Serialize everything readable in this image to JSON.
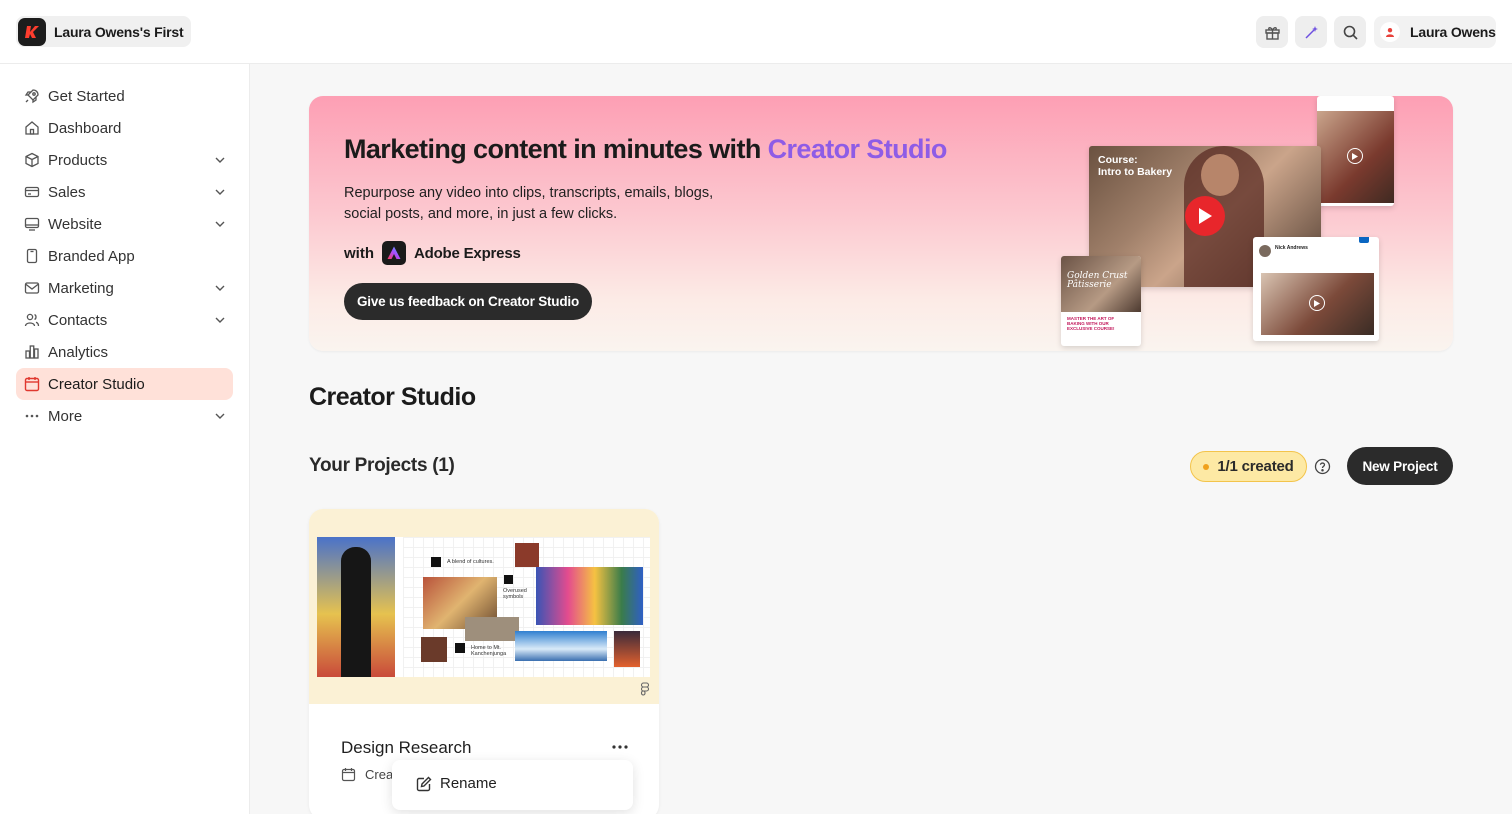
{
  "app": {
    "workspace_name": "Laura Owens's First",
    "user_name": "Laura Owens",
    "colors": {
      "accent": "#8e5ce6",
      "active_nav_bg": "#ffe1d9",
      "dark_button": "#2b2b2b",
      "badge_bg": "#fde9a4"
    }
  },
  "topbar": {
    "icons": [
      "gift-icon",
      "sparkle-wand-icon",
      "search-icon",
      "user-avatar-icon"
    ]
  },
  "sidebar": {
    "items": [
      {
        "label": "Get Started",
        "icon": "rocket-icon",
        "expandable": false,
        "active": false
      },
      {
        "label": "Dashboard",
        "icon": "home-icon",
        "expandable": false,
        "active": false
      },
      {
        "label": "Products",
        "icon": "box-icon",
        "expandable": true,
        "active": false
      },
      {
        "label": "Sales",
        "icon": "credit-card-icon",
        "expandable": true,
        "active": false
      },
      {
        "label": "Website",
        "icon": "monitor-icon",
        "expandable": true,
        "active": false
      },
      {
        "label": "Branded App",
        "icon": "phone-icon",
        "expandable": false,
        "active": false
      },
      {
        "label": "Marketing",
        "icon": "mail-icon",
        "expandable": true,
        "active": false
      },
      {
        "label": "Contacts",
        "icon": "users-icon",
        "expandable": true,
        "active": false
      },
      {
        "label": "Analytics",
        "icon": "bar-chart-icon",
        "expandable": false,
        "active": false
      },
      {
        "label": "Creator Studio",
        "icon": "calendar-icon",
        "expandable": false,
        "active": true
      },
      {
        "label": "More",
        "icon": "dots-icon",
        "expandable": true,
        "active": false
      }
    ]
  },
  "banner": {
    "title_prefix": "Marketing content in minutes with ",
    "title_accent": "Creator Studio",
    "subtitle": "Repurpose any video into clips, transcripts, emails, blogs, social posts, and more, in just a few clicks.",
    "with_label": "with",
    "partner": "Adobe Express",
    "cta": "Give us feedback on Creator Studio",
    "video_caption_line1": "Course:",
    "video_caption_line2": "Intro to Bakery",
    "card_title_line1": "Golden Crust",
    "card_title_line2": "Pâtisserie",
    "card_text": "MASTER THE ART OF BAKING WITH OUR EXCLUSIVE COURSE!",
    "li_author": "Nick Andrews"
  },
  "main": {
    "page_title": "Creator Studio",
    "section_title": "Your Projects (1)",
    "created_badge": "1/1 created",
    "new_project": "New Project"
  },
  "projects": [
    {
      "name": "Design Research",
      "created_label": "Crea",
      "slide_captions": [
        "A blend of cultures.",
        "Overused symbols",
        "Home to Mt. Kanchenjunga"
      ]
    }
  ],
  "menu": {
    "items": [
      {
        "label": "Rename",
        "icon": "edit-icon"
      }
    ]
  }
}
